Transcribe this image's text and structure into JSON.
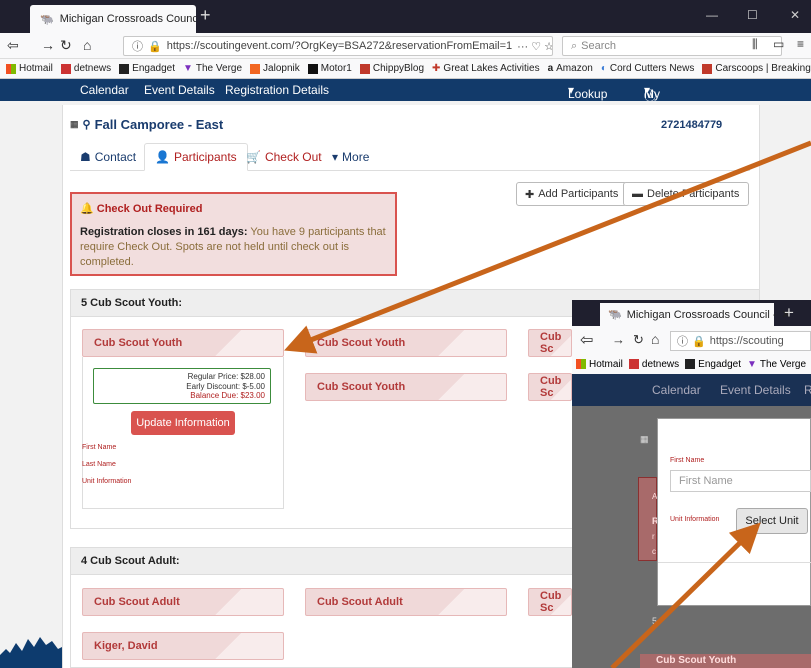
{
  "browser": {
    "tab_title": "Michigan Crossroads Council -",
    "url": "https://scoutingevent.com/?OrgKey=BSA272&reservationFromEmail=1",
    "search_placeholder": "Search",
    "bookmarks": [
      "Hotmail",
      "detnews",
      "Engadget",
      "The Verge",
      "Jalopnik",
      "Motor1",
      "ChippyBlog",
      "Great Lakes Activities",
      "Amazon",
      "Cord Cutters News",
      "Carscoops | Breaking ..."
    ]
  },
  "site_nav": {
    "calendar": "Calendar",
    "event_details": "Event Details",
    "registration_details": "Registration Details",
    "lookup": "Lookup",
    "my_account": "My Account"
  },
  "event": {
    "title": "Fall Camporee - East",
    "id": "2721484779"
  },
  "tabs": {
    "contact": "Contact",
    "participants": "Participants",
    "check_out": "Check Out",
    "more": "More"
  },
  "actions": {
    "add": "Add Participants",
    "delete": "Delete Participants"
  },
  "alert": {
    "title": "Check Out Required",
    "bold": "Registration closes in 161 days:",
    "text": "You have 9 participants that require Check Out. Spots are not held until check out is completed."
  },
  "youth_section": {
    "header": "5 Cub Scout Youth:",
    "cards": [
      "Cub Scout Youth",
      "Cub Scout Youth",
      "Cub Sc",
      "Cub Scout Youth",
      "Cub Sc"
    ],
    "price": {
      "regular": "Regular Price:  $28.00",
      "discount": "Early Discount:  $-5.00",
      "due": "Balance Due:  $23.00"
    },
    "update_btn": "Update Information",
    "fields": [
      "First Name",
      "Last Name",
      "Unit Information"
    ]
  },
  "adult_section": {
    "header": "4 Cub Scout Adult:",
    "cards": [
      "Cub Scout Adult",
      "Cub Scout Adult",
      "Cub Sc",
      "Kiger, David"
    ]
  },
  "overlay": {
    "tab_title": "Michigan Crossroads Council -",
    "url": "https://scouting",
    "bookmarks": [
      "Hotmail",
      "detnews",
      "Engadget",
      "The Verge"
    ],
    "site_nav": [
      "Calendar",
      "Event Details",
      "R"
    ],
    "first_name_label": "First Name",
    "first_name_placeholder": "First Name",
    "unit_label": "Unit Information",
    "select_unit": "Select Unit",
    "bg_letters": [
      "R",
      "A",
      "r",
      "c",
      "5"
    ],
    "bottom_card": "Cub Scout Youth"
  },
  "colors": {
    "navy": "#123a6a",
    "alert_red": "#d9534f",
    "arrow": "#c8651b"
  }
}
